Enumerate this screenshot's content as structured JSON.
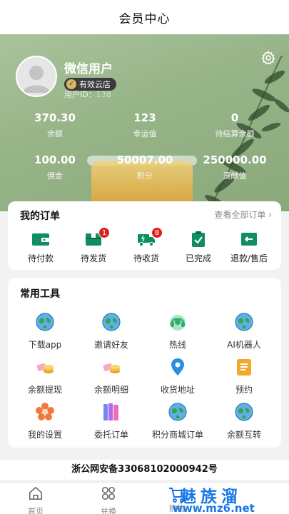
{
  "header": {
    "title": "会员中心"
  },
  "profile": {
    "username": "微信用户",
    "store_badge": "有效云店",
    "uid_label": "用户ID：",
    "uid_value": "138"
  },
  "stats": [
    {
      "value": "370.30",
      "label": "余额"
    },
    {
      "value": "123",
      "label": "幸运值"
    },
    {
      "value": "0",
      "label": "待结算余额"
    },
    {
      "value": "100.00",
      "label": "佣金"
    },
    {
      "value": "50007.00",
      "label": "积分"
    },
    {
      "value": "250000.00",
      "label": "贡献值"
    }
  ],
  "orders": {
    "title": "我的订单",
    "view_all": "查看全部订单",
    "items": [
      {
        "label": "待付款",
        "icon": "wallet-icon"
      },
      {
        "label": "待发货",
        "icon": "package-icon",
        "badge": "1"
      },
      {
        "label": "待收货",
        "icon": "truck-icon",
        "badge": "8"
      },
      {
        "label": "已完成",
        "icon": "clipboard-check-icon"
      },
      {
        "label": "退款/售后",
        "icon": "refund-icon"
      }
    ]
  },
  "tools": {
    "title": "常用工具",
    "items": [
      {
        "label": "下载app",
        "icon": "globe-icon"
      },
      {
        "label": "邀请好友",
        "icon": "globe-icon"
      },
      {
        "label": "热线",
        "icon": "headset-icon"
      },
      {
        "label": "AI机器人",
        "icon": "globe-icon"
      },
      {
        "label": "余额提现",
        "icon": "coins-icon"
      },
      {
        "label": "余额明细",
        "icon": "coins-icon"
      },
      {
        "label": "收货地址",
        "icon": "location-pin-icon"
      },
      {
        "label": "预约",
        "icon": "notepad-icon"
      },
      {
        "label": "我的设置",
        "icon": "flower-settings-icon"
      },
      {
        "label": "委托订单",
        "icon": "color-books-icon"
      },
      {
        "label": "积分商城订单",
        "icon": "globe-icon"
      },
      {
        "label": "余额互转",
        "icon": "globe-icon"
      }
    ]
  },
  "footer": {
    "beian": "浙公网安备33068102000942号"
  },
  "tabbar": [
    {
      "label": "首页",
      "icon": "home-icon"
    },
    {
      "label": "兑换",
      "icon": "grid-icon"
    },
    {
      "label": "购物",
      "icon": "cart-icon"
    }
  ],
  "watermark": {
    "big": "魅族溜",
    "small": "www.mz6.net"
  },
  "colors": {
    "accent": "#0f8f5f",
    "badge": "#e02020",
    "hero": "#9ab78b",
    "watermark": "#1a78e6"
  }
}
